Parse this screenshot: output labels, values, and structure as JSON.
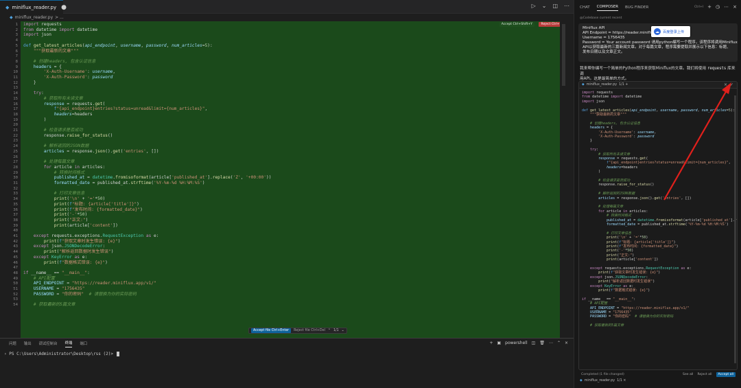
{
  "editor": {
    "tab_name": "miniflux_reader.py",
    "tab_modified": "●",
    "breadcrumb_file": "miniflux_reader.py",
    "breadcrumb_sep": "> ...",
    "accept_label": "Accept Ctrl+Shift+Y",
    "reject_label": "Reject Ctrl+N",
    "accept_file_label": "Accept file Ctrl+Enter",
    "reject_file_label": "Reject file Ctrl+Del",
    "diff_counter": "1/1"
  },
  "code_lines": [
    [
      [
        "kw",
        "import"
      ],
      [
        "pl",
        " requests"
      ]
    ],
    [
      [
        "kw",
        "from"
      ],
      [
        "pl",
        " datetime "
      ],
      [
        "kw",
        "import"
      ],
      [
        "pl",
        " datetime"
      ]
    ],
    [
      [
        "kw",
        "import"
      ],
      [
        "pl",
        " json"
      ]
    ],
    [],
    [
      [
        "bl",
        "def"
      ],
      [
        "pl",
        " "
      ],
      [
        "fn",
        "get_latest_articles"
      ],
      [
        "pl",
        "("
      ],
      [
        "it",
        "api_endpoint"
      ],
      [
        "pl",
        ", "
      ],
      [
        "it",
        "username"
      ],
      [
        "pl",
        ", "
      ],
      [
        "it",
        "password"
      ],
      [
        "pl",
        ", "
      ],
      [
        "it",
        "num_articles"
      ],
      [
        "pl",
        "="
      ],
      [
        "nm",
        "5"
      ],
      [
        "pl",
        "):"
      ]
    ],
    [
      [
        "pl",
        "    "
      ],
      [
        "st",
        "\"\"\"获取最新的文章\"\"\""
      ]
    ],
    [],
    [
      [
        "pl",
        "    "
      ],
      [
        "cm",
        "# 创建headers, 包含认证信息"
      ]
    ],
    [
      [
        "pl",
        "    "
      ],
      [
        "pr",
        "headers"
      ],
      [
        "pl",
        " = {"
      ]
    ],
    [
      [
        "pl",
        "        "
      ],
      [
        "st",
        "'X-Auth-Username'"
      ],
      [
        "pl",
        ": "
      ],
      [
        "it",
        "username"
      ],
      [
        "pl",
        ","
      ]
    ],
    [
      [
        "pl",
        "        "
      ],
      [
        "st",
        "'X-Auth-Password'"
      ],
      [
        "pl",
        ": "
      ],
      [
        "it",
        "password"
      ]
    ],
    [
      [
        "pl",
        "    }"
      ]
    ],
    [],
    [
      [
        "pl",
        "    "
      ],
      [
        "kw",
        "try"
      ],
      [
        "pl",
        ":"
      ]
    ],
    [
      [
        "pl",
        "        "
      ],
      [
        "cm",
        "# 获取所有未读文章"
      ]
    ],
    [
      [
        "pl",
        "        "
      ],
      [
        "pr",
        "response"
      ],
      [
        "pl",
        " = requests."
      ],
      [
        "fn",
        "get"
      ],
      [
        "pl",
        "("
      ]
    ],
    [
      [
        "pl",
        "            "
      ],
      [
        "bl",
        "f"
      ],
      [
        "st",
        "\"{api_endpoint}entries?status=unread&limit={num_articles}\""
      ],
      [
        "pl",
        ","
      ]
    ],
    [
      [
        "pl",
        "            "
      ],
      [
        "it",
        "headers"
      ],
      [
        "pl",
        "=headers"
      ]
    ],
    [
      [
        "pl",
        "        )"
      ]
    ],
    [],
    [
      [
        "pl",
        "        "
      ],
      [
        "cm",
        "# 检查请求是否成功"
      ]
    ],
    [
      [
        "pl",
        "        response."
      ],
      [
        "fn",
        "raise_for_status"
      ],
      [
        "pl",
        "()"
      ]
    ],
    [],
    [
      [
        "pl",
        "        "
      ],
      [
        "cm",
        "# 解析返回的JSON数据"
      ]
    ],
    [
      [
        "pl",
        "        "
      ],
      [
        "pr",
        "articles"
      ],
      [
        "pl",
        " = response."
      ],
      [
        "fn",
        "json"
      ],
      [
        "pl",
        "()."
      ],
      [
        "fn",
        "get"
      ],
      [
        "pl",
        "("
      ],
      [
        "st",
        "'entries'"
      ],
      [
        "pl",
        ", [])"
      ]
    ],
    [],
    [
      [
        "pl",
        "        "
      ],
      [
        "cm",
        "# 处理每篇文章"
      ]
    ],
    [
      [
        "pl",
        "        "
      ],
      [
        "kw",
        "for"
      ],
      [
        "pl",
        " article "
      ],
      [
        "kw",
        "in"
      ],
      [
        "pl",
        " articles:"
      ]
    ],
    [
      [
        "pl",
        "            "
      ],
      [
        "cm",
        "# 转换时间格式"
      ]
    ],
    [
      [
        "pl",
        "            "
      ],
      [
        "pr",
        "published_at"
      ],
      [
        "pl",
        " = "
      ],
      [
        "cls",
        "datetime"
      ],
      [
        "pl",
        "."
      ],
      [
        "fn",
        "fromisoformat"
      ],
      [
        "pl",
        "(article["
      ],
      [
        "st",
        "'published_at'"
      ],
      [
        "pl",
        "]."
      ],
      [
        "fn",
        "replace"
      ],
      [
        "pl",
        "("
      ],
      [
        "st",
        "'Z'"
      ],
      [
        "pl",
        ", "
      ],
      [
        "st",
        "'+00:00'"
      ],
      [
        "pl",
        "))"
      ]
    ],
    [
      [
        "pl",
        "            "
      ],
      [
        "pr",
        "formatted_date"
      ],
      [
        "pl",
        " = published_at."
      ],
      [
        "fn",
        "strftime"
      ],
      [
        "pl",
        "("
      ],
      [
        "st",
        "'%Y-%m-%d %H:%M:%S'"
      ],
      [
        "pl",
        ")"
      ]
    ],
    [],
    [
      [
        "pl",
        "            "
      ],
      [
        "cm",
        "# 打印文章信息"
      ]
    ],
    [
      [
        "pl",
        "            "
      ],
      [
        "fn",
        "print"
      ],
      [
        "pl",
        "("
      ],
      [
        "st",
        "'\\n'"
      ],
      [
        "pl",
        " + "
      ],
      [
        "st",
        "'='"
      ],
      [
        "pl",
        "*"
      ],
      [
        "nm",
        "50"
      ],
      [
        "pl",
        ")"
      ]
    ],
    [
      [
        "pl",
        "            "
      ],
      [
        "fn",
        "print"
      ],
      [
        "pl",
        "("
      ],
      [
        "bl",
        "f"
      ],
      [
        "st",
        "\"标题: {article['title']}\""
      ],
      [
        "pl",
        ")"
      ]
    ],
    [
      [
        "pl",
        "            "
      ],
      [
        "fn",
        "print"
      ],
      [
        "pl",
        "("
      ],
      [
        "bl",
        "f"
      ],
      [
        "st",
        "\"发布时间: {formatted_date}\""
      ],
      [
        "pl",
        ")"
      ]
    ],
    [
      [
        "pl",
        "            "
      ],
      [
        "fn",
        "print"
      ],
      [
        "pl",
        "("
      ],
      [
        "st",
        "'-'"
      ],
      [
        "pl",
        "*"
      ],
      [
        "nm",
        "50"
      ],
      [
        "pl",
        ")"
      ]
    ],
    [
      [
        "pl",
        "            "
      ],
      [
        "fn",
        "print"
      ],
      [
        "pl",
        "("
      ],
      [
        "st",
        "\"正文:\""
      ],
      [
        "pl",
        ")"
      ]
    ],
    [
      [
        "pl",
        "            "
      ],
      [
        "fn",
        "print"
      ],
      [
        "pl",
        "(article["
      ],
      [
        "st",
        "'content'"
      ],
      [
        "pl",
        "])"
      ]
    ],
    [],
    [
      [
        "pl",
        "    "
      ],
      [
        "kw",
        "except"
      ],
      [
        "pl",
        " requests.exceptions."
      ],
      [
        "cls",
        "RequestException"
      ],
      [
        "pl",
        " "
      ],
      [
        "kw",
        "as"
      ],
      [
        "pl",
        " e:"
      ]
    ],
    [
      [
        "pl",
        "        "
      ],
      [
        "fn",
        "print"
      ],
      [
        "pl",
        "("
      ],
      [
        "bl",
        "f"
      ],
      [
        "st",
        "\"获取文章时发生错误: {e}\""
      ],
      [
        "pl",
        ")"
      ]
    ],
    [
      [
        "pl",
        "    "
      ],
      [
        "kw",
        "except"
      ],
      [
        "pl",
        " json."
      ],
      [
        "cls",
        "JSONDecodeError"
      ],
      [
        "pl",
        ":"
      ]
    ],
    [
      [
        "pl",
        "        "
      ],
      [
        "fn",
        "print"
      ],
      [
        "pl",
        "("
      ],
      [
        "st",
        "\"解析返回数据时发生错误\""
      ],
      [
        "pl",
        ")"
      ]
    ],
    [
      [
        "pl",
        "    "
      ],
      [
        "kw",
        "except"
      ],
      [
        "pl",
        " "
      ],
      [
        "cls",
        "KeyError"
      ],
      [
        "pl",
        " "
      ],
      [
        "kw",
        "as"
      ],
      [
        "pl",
        " e:"
      ]
    ],
    [
      [
        "pl",
        "        "
      ],
      [
        "fn",
        "print"
      ],
      [
        "pl",
        "("
      ],
      [
        "bl",
        "f"
      ],
      [
        "st",
        "\"数据格式错误: {e}\""
      ],
      [
        "pl",
        ")"
      ]
    ],
    [],
    [
      [
        "kw",
        "if"
      ],
      [
        "pl",
        " __name__ == "
      ],
      [
        "st",
        "\"__main__\""
      ],
      [
        "pl",
        ":"
      ]
    ],
    [
      [
        "pl",
        "    "
      ],
      [
        "cm",
        "# API配置"
      ]
    ],
    [
      [
        "pl",
        "    "
      ],
      [
        "pr",
        "API_ENDPOINT"
      ],
      [
        "pl",
        " = "
      ],
      [
        "st",
        "\"https://reader.miniflux.app/v1/\""
      ]
    ],
    [
      [
        "pl",
        "    "
      ],
      [
        "pr",
        "USERNAME"
      ],
      [
        "pl",
        " = "
      ],
      [
        "st",
        "\"1756435\""
      ]
    ],
    [
      [
        "pl",
        "    "
      ],
      [
        "pr",
        "PASSWORD"
      ],
      [
        "pl",
        " = "
      ],
      [
        "st",
        "\"你的密码\""
      ],
      [
        "pl",
        "  "
      ],
      [
        "cm",
        "# 请替换为你的实际密码"
      ]
    ],
    [],
    [
      [
        "pl",
        "    "
      ],
      [
        "cm",
        "# 获取最新的5篇文章"
      ]
    ]
  ],
  "panel": {
    "tabs": [
      "问题",
      "输出",
      "调试控制台",
      "终端",
      "端口"
    ],
    "active_tab": 3,
    "shell_label": "powershell",
    "prompt": "PS C:\\Users\\Administrator\\Desktop\\rss (2)>"
  },
  "chat": {
    "tabs": [
      "CHAT",
      "COMPOSER",
      "BUG FINDER"
    ],
    "active_tab": 1,
    "top_hint": "Ctrl+I",
    "context_line": "@Codebase  current  recent",
    "prompt_lines": [
      "Miniflux API",
      "API Endpoint = https://reader.miniflux.app/v1/",
      "Username = 1756435",
      "Password = Your account password  请用python编写一个程序，该程序将调用Miniflux",
      "API以获取最新的三篇新闻文章。对于每篇文章，程序需要提取并展示以下信息：标题、",
      "发布日期以及文章正文。"
    ],
    "baidu_badge": "百度登录上传",
    "assistant_text_1": "我来帮你编写一个简单的Python程序来获取Miniflux的文章。我们将使用",
    "assistant_mono": "requests",
    "assistant_text_2": "库来调",
    "assistant_text_3": "用API。这是最简单的方式。",
    "code_block_file": "miniflux_reader.py",
    "code_block_sep": "1/1 +",
    "footer_status": "Completed (1 file changed)",
    "see_all": "See all",
    "reject_all": "Reject all",
    "accept_all": "Accept all",
    "bottom_file": "miniflux_reader.py",
    "bottom_sep": "1/1 ×"
  },
  "colors": {
    "editor_bg": "#1e1e1e",
    "diff_added_bg": "#1b4a1b",
    "accent_blue": "#0e639c",
    "reject_red": "#b93b3b",
    "arrow_red": "#e0201c"
  },
  "icons": [
    "python-file-icon",
    "run-icon",
    "split-editor-icon",
    "more-icon",
    "close-icon",
    "check-icon",
    "plus-icon",
    "history-icon",
    "baidu-cloud-icon",
    "trash-icon",
    "terminal-icon"
  ]
}
